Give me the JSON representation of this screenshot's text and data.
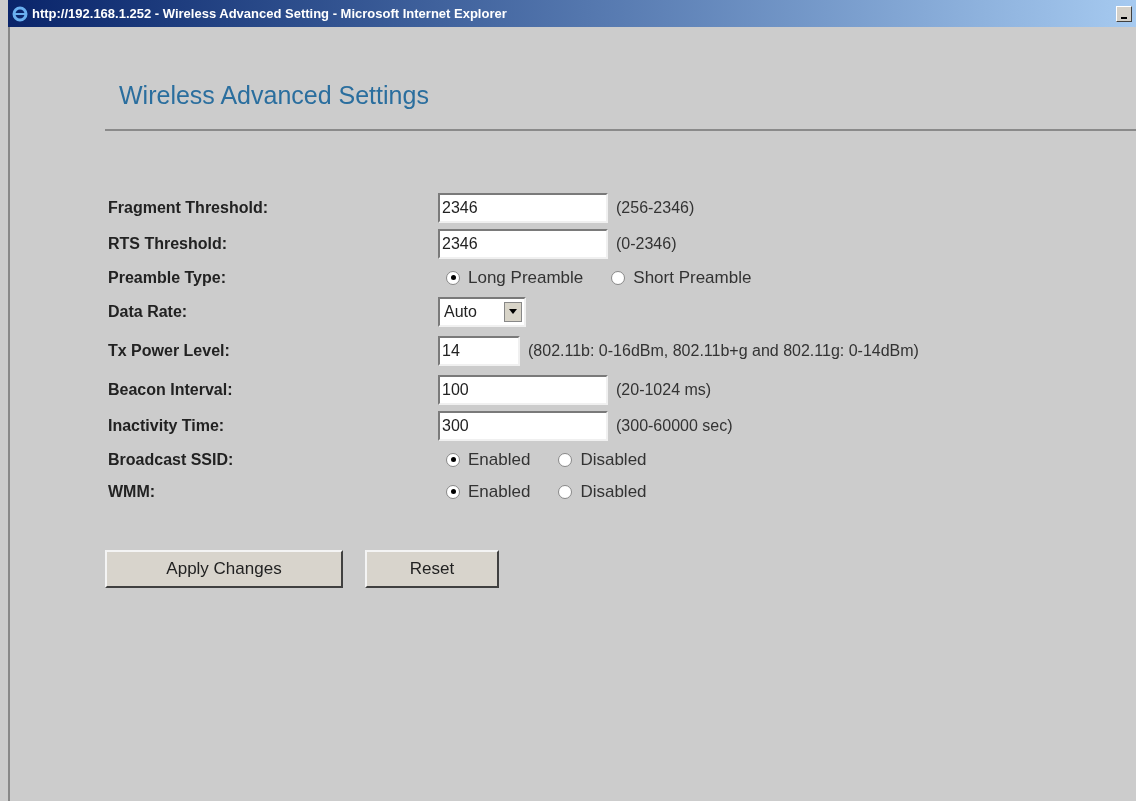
{
  "window": {
    "title": "http://192.168.1.252 - Wireless Advanced Setting - Microsoft Internet Explorer"
  },
  "heading": "Wireless Advanced Settings",
  "rows": [
    {
      "kind": "text",
      "label": "Fragment Threshold:",
      "value": "2346",
      "hint": "(256-2346)"
    },
    {
      "kind": "text",
      "label": "RTS Threshold:",
      "value": "2346",
      "hint": "(0-2346)"
    },
    {
      "kind": "radio",
      "label": "Preamble Type:",
      "options": [
        {
          "label": "Long Preamble",
          "selected": true
        },
        {
          "label": "Short Preamble",
          "selected": false
        }
      ]
    },
    {
      "kind": "select",
      "label": "Data Rate:",
      "value": "Auto"
    },
    {
      "kind": "short",
      "label": "Tx Power Level:",
      "value": "14",
      "hint": "(802.11b: 0-16dBm, 802.11b+g and 802.11g: 0-14dBm)"
    },
    {
      "kind": "text",
      "label": "Beacon Interval:",
      "value": "100",
      "hint": "(20-1024 ms)"
    },
    {
      "kind": "text",
      "label": "Inactivity Time:",
      "value": "300",
      "hint": "(300-60000 sec)"
    },
    {
      "kind": "radio",
      "label": "Broadcast SSID:",
      "options": [
        {
          "label": "Enabled",
          "selected": true
        },
        {
          "label": "Disabled",
          "selected": false
        }
      ]
    },
    {
      "kind": "radio",
      "label": "WMM:",
      "options": [
        {
          "label": "Enabled",
          "selected": true
        },
        {
          "label": "Disabled",
          "selected": false
        }
      ]
    }
  ],
  "buttons": [
    "Apply Changes",
    "Reset"
  ]
}
